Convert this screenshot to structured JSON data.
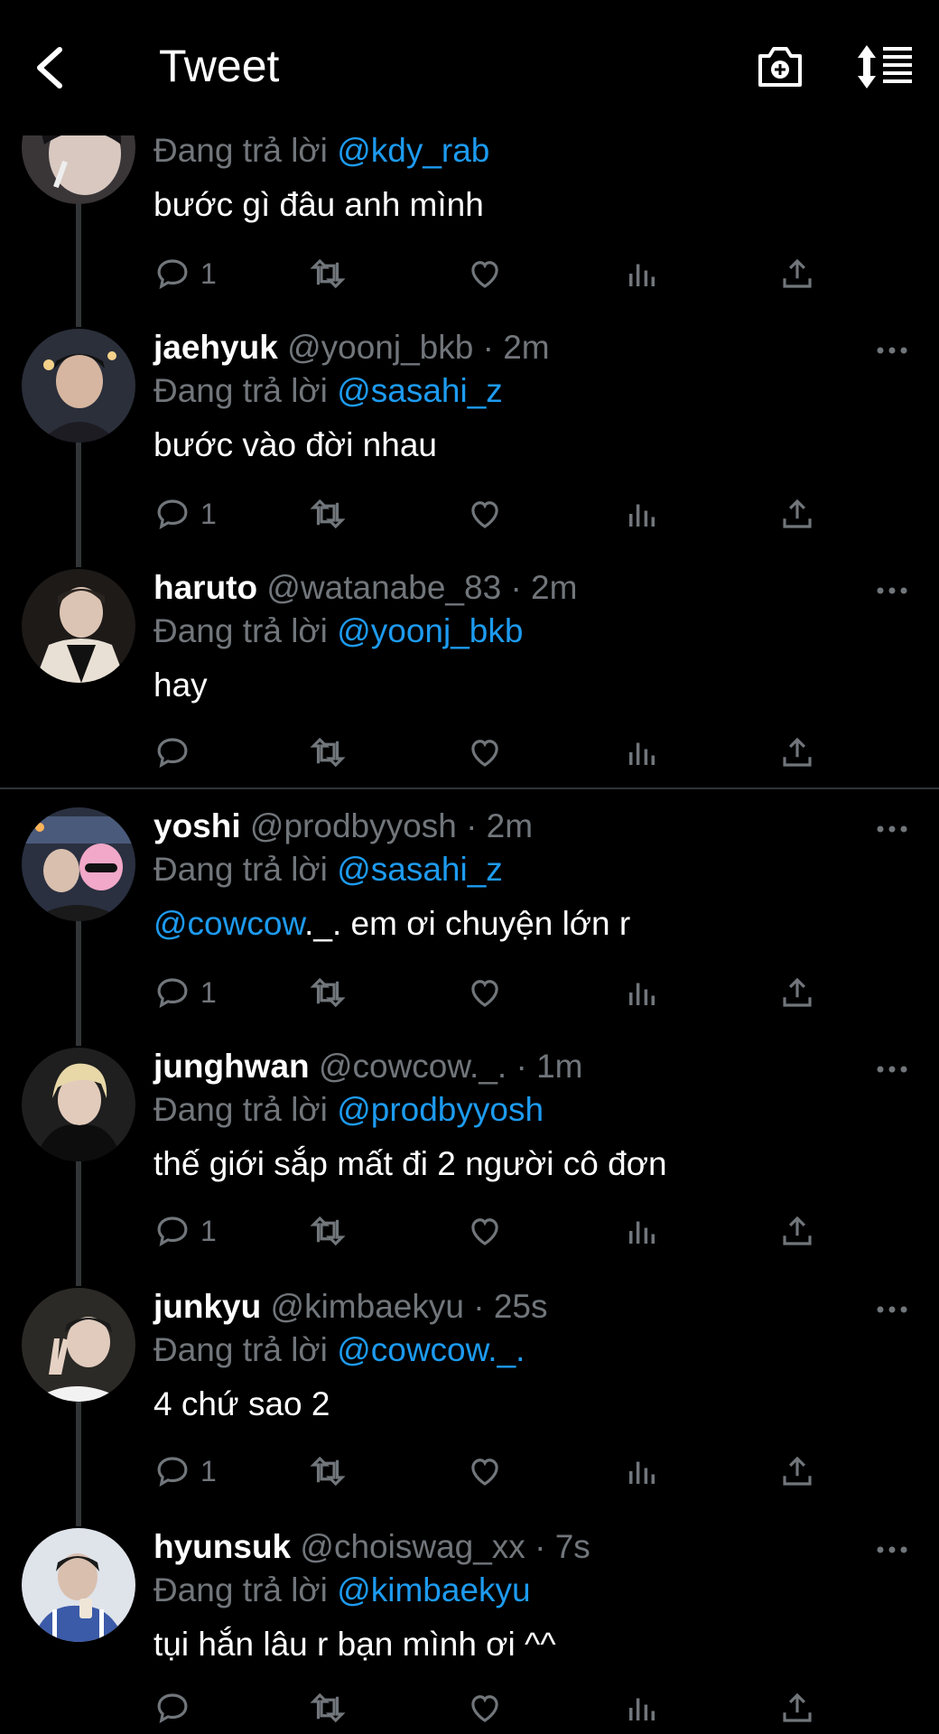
{
  "header": {
    "title": "Tweet",
    "back_icon": "chevron-left-icon",
    "camera_icon": "camera-plus-icon",
    "sort_icon": "sort-icon"
  },
  "colors": {
    "background": "#000000",
    "text": "#ffffff",
    "muted": "#71767b",
    "accent": "#1d9bf0"
  },
  "tweets": [
    {
      "name": "",
      "handle": "",
      "time": "",
      "reply_prefix": "Đang trả lời",
      "reply_to": "@kdy_rab",
      "text_mention": "",
      "text": "bước gì đâu anh mình",
      "reply_count": "1"
    },
    {
      "name": "jaehyuk",
      "handle": "@yoonj_bkb",
      "time": "· 2m",
      "reply_prefix": "Đang trả lời",
      "reply_to": "@sasahi_z",
      "text_mention": "",
      "text": "bước vào đời nhau",
      "reply_count": "1"
    },
    {
      "name": "haruto",
      "handle": "@watanabe_83",
      "time": "· 2m",
      "reply_prefix": "Đang trả lời",
      "reply_to": "@yoonj_bkb",
      "text_mention": "",
      "text": "hay",
      "reply_count": ""
    },
    {
      "name": "yoshi",
      "handle": "@prodbyyosh",
      "time": "· 2m",
      "reply_prefix": "Đang trả lời",
      "reply_to": "@sasahi_z",
      "text_mention": "@cowcow",
      "text": "._. em ơi chuyện lớn r",
      "reply_count": "1"
    },
    {
      "name": "junghwan",
      "handle": "@cowcow._.",
      "time": "· 1m",
      "reply_prefix": "Đang trả lời",
      "reply_to": "@prodbyyosh",
      "text_mention": "",
      "text": "thế giới sắp mất đi 2 người cô đơn",
      "reply_count": "1"
    },
    {
      "name": "junkyu",
      "handle": "@kimbaekyu",
      "time": "· 25s",
      "reply_prefix": "Đang trả lời",
      "reply_to": "@cowcow._.",
      "text_mention": "",
      "text": "4 chứ sao 2",
      "reply_count": "1"
    },
    {
      "name": "hyunsuk",
      "handle": "@choiswag_xx",
      "time": "· 7s",
      "reply_prefix": "Đang trả lời",
      "reply_to": "@kimbaekyu",
      "text_mention": "",
      "text": "tụi hắn lâu r bạn mình ơi ^^",
      "reply_count": ""
    }
  ]
}
